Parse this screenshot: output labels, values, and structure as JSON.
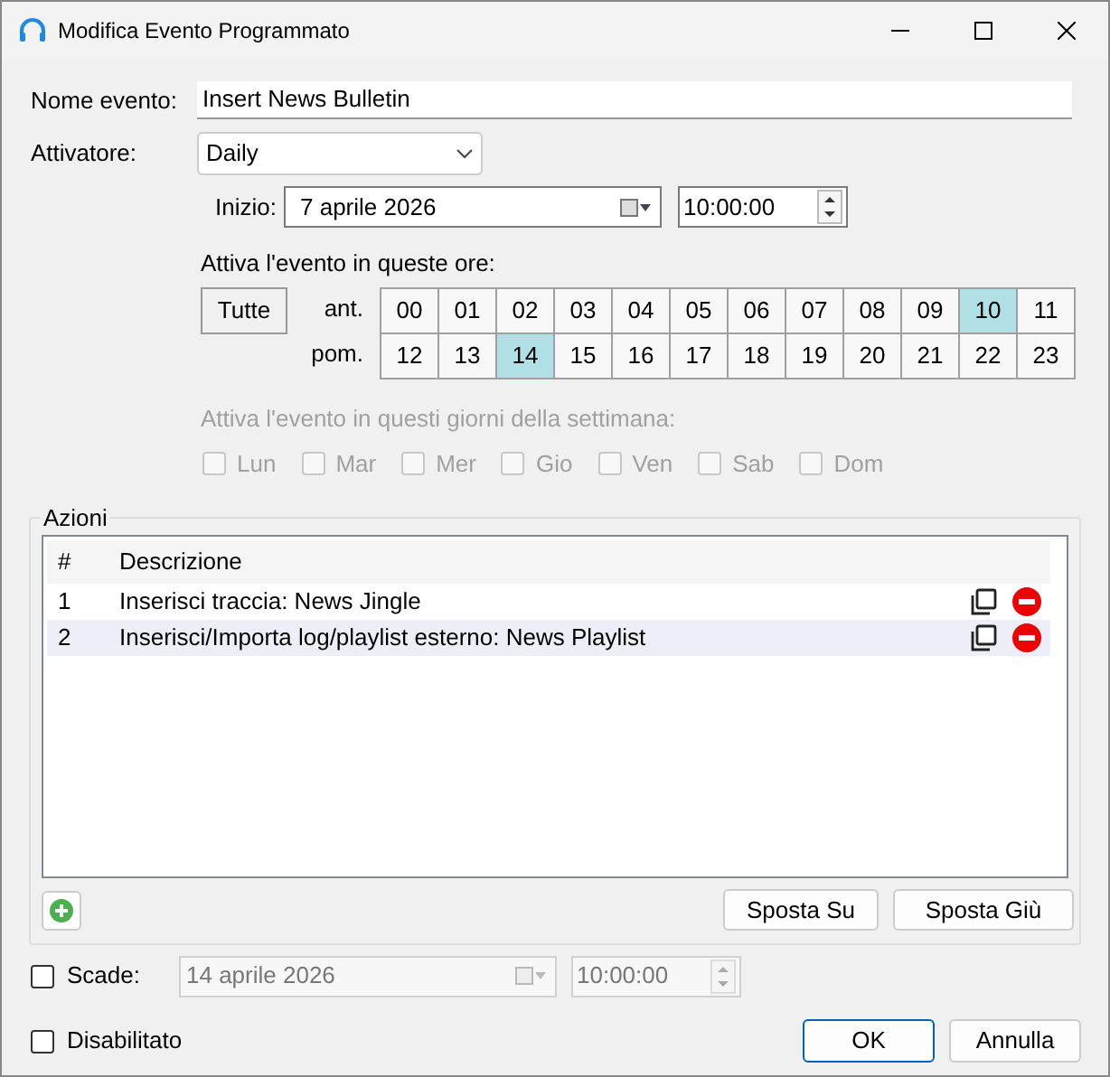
{
  "window": {
    "title": "Modifica Evento Programmato"
  },
  "event_name": {
    "label": "Nome evento:",
    "value": "Insert News Bulletin"
  },
  "trigger": {
    "label": "Attivatore:",
    "value": "Daily"
  },
  "start": {
    "label": "Inizio:",
    "date": "7 aprile 2026",
    "time": "10:00:00"
  },
  "hours": {
    "label": "Attiva l'evento in queste ore:",
    "all_button": "Tutte",
    "rows": [
      {
        "label": "ant.",
        "cells": [
          {
            "text": "00",
            "selected": false
          },
          {
            "text": "01",
            "selected": false
          },
          {
            "text": "02",
            "selected": false
          },
          {
            "text": "03",
            "selected": false
          },
          {
            "text": "04",
            "selected": false
          },
          {
            "text": "05",
            "selected": false
          },
          {
            "text": "06",
            "selected": false
          },
          {
            "text": "07",
            "selected": false
          },
          {
            "text": "08",
            "selected": false
          },
          {
            "text": "09",
            "selected": false
          },
          {
            "text": "10",
            "selected": true
          },
          {
            "text": "11",
            "selected": false
          }
        ]
      },
      {
        "label": "pom.",
        "cells": [
          {
            "text": "12",
            "selected": false
          },
          {
            "text": "13",
            "selected": false
          },
          {
            "text": "14",
            "selected": true
          },
          {
            "text": "15",
            "selected": false
          },
          {
            "text": "16",
            "selected": false
          },
          {
            "text": "17",
            "selected": false
          },
          {
            "text": "18",
            "selected": false
          },
          {
            "text": "19",
            "selected": false
          },
          {
            "text": "20",
            "selected": false
          },
          {
            "text": "21",
            "selected": false
          },
          {
            "text": "22",
            "selected": false
          },
          {
            "text": "23",
            "selected": false
          }
        ]
      }
    ]
  },
  "weekdays": {
    "label": "Attiva l'evento in questi giorni della settimana:",
    "disabled": true,
    "days": [
      {
        "label": "Lun",
        "checked": false
      },
      {
        "label": "Mar",
        "checked": false
      },
      {
        "label": "Mer",
        "checked": false
      },
      {
        "label": "Gio",
        "checked": false
      },
      {
        "label": "Ven",
        "checked": false
      },
      {
        "label": "Sab",
        "checked": false
      },
      {
        "label": "Dom",
        "checked": false
      }
    ]
  },
  "actions": {
    "title": "Azioni",
    "columns": [
      "#",
      "Descrizione"
    ],
    "rows": [
      {
        "number": "1",
        "description": "Inserisci traccia: News Jingle",
        "selected": false
      },
      {
        "number": "2",
        "description": "Inserisci/Importa log/playlist esterno: News Playlist",
        "selected": true
      }
    ],
    "buttons": [
      "Sposta Su",
      "Sposta Giù"
    ]
  },
  "expires": {
    "label": "Scade:",
    "checked": false,
    "date": "14 aprile 2026",
    "time": "10:00:00",
    "disabled": true
  },
  "disabled_option": {
    "label": "Disabilitato",
    "checked": false
  },
  "buttons": [
    {
      "label": "OK",
      "default": true
    },
    {
      "label": "Annulla",
      "default": false
    }
  ]
}
